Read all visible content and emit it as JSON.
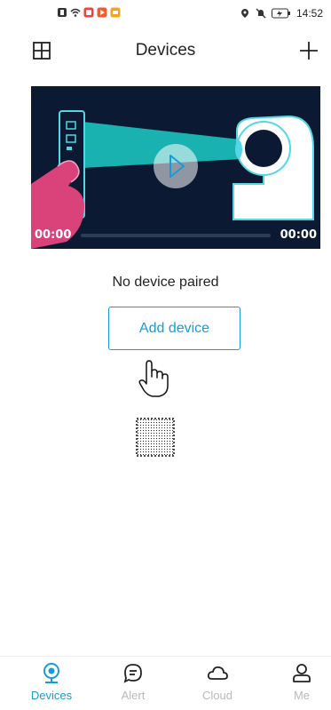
{
  "status_bar": {
    "time": "14:52"
  },
  "header": {
    "title": "Devices"
  },
  "video": {
    "start_time": "00:00",
    "end_time": "00:00"
  },
  "main": {
    "empty_message": "No device paired",
    "add_button": "Add device"
  },
  "nav": {
    "tabs": [
      {
        "label": "Devices",
        "icon": "camera-icon",
        "active": true
      },
      {
        "label": "Alert",
        "icon": "message-icon",
        "active": false
      },
      {
        "label": "Cloud",
        "icon": "cloud-icon",
        "active": false
      },
      {
        "label": "Me",
        "icon": "person-icon",
        "active": false
      }
    ]
  },
  "colors": {
    "accent": "#1a9bd6",
    "video_bg": "#0b1933",
    "beam": "#1ab2b0",
    "hand": "#d9437a"
  }
}
